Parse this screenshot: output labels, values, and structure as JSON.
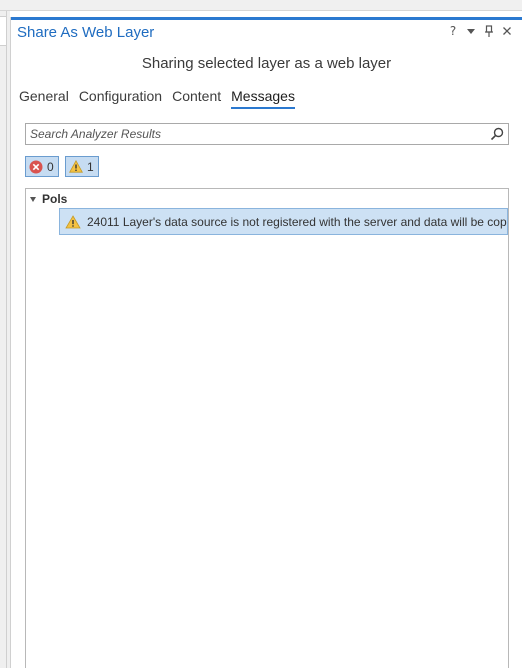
{
  "pane": {
    "title": "Share As Web Layer",
    "controls": {
      "help": "?",
      "pin": "📌",
      "close": "✕"
    },
    "subtitle": "Sharing selected layer as a web layer"
  },
  "tabs": [
    {
      "label": "General",
      "active": false
    },
    {
      "label": "Configuration",
      "active": false
    },
    {
      "label": "Content",
      "active": false
    },
    {
      "label": "Messages",
      "active": true
    }
  ],
  "search": {
    "placeholder": "Search Analyzer Results",
    "value": ""
  },
  "filters": {
    "errors": {
      "count": "0",
      "icon": "error-icon"
    },
    "warnings": {
      "count": "1",
      "icon": "warning-icon"
    }
  },
  "results": {
    "group": {
      "label": "Pols",
      "expanded": true
    },
    "messages": [
      {
        "type": "warning",
        "text": "24011 Layer's data source is not registered with the server and data will be cop"
      }
    ]
  },
  "colors": {
    "accent": "#2b79d0",
    "title": "#1f6cc0",
    "selection": "#cde1f4",
    "filter_bg": "#c6dcf2",
    "error_red": "#d9534f",
    "warning_yellow": "#f5c242"
  }
}
